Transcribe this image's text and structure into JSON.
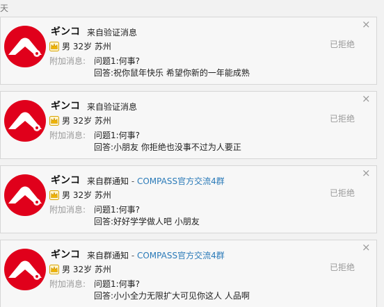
{
  "header": {
    "day_label": "天"
  },
  "requests": [
    {
      "name": "ギンコ",
      "source": "来自验证消息",
      "dash": "",
      "group": "",
      "profile": "男 32岁 苏州",
      "extra_label": "附加消息:",
      "question": "问题1:何事?",
      "answer": "回答:祝你鼠年快乐 希望你新的一年能成熟",
      "status": "已拒绝",
      "close": "×"
    },
    {
      "name": "ギンコ",
      "source": "来自验证消息",
      "dash": "",
      "group": "",
      "profile": "男 32岁 苏州",
      "extra_label": "附加消息:",
      "question": "问题1:何事?",
      "answer": "回答:小朋友 你拒绝也没事不过为人要正",
      "status": "已拒绝",
      "close": "×"
    },
    {
      "name": "ギンコ",
      "source": "来自群通知",
      "dash": " - ",
      "group": "COMPASS官方交流4群",
      "profile": "男 32岁 苏州",
      "extra_label": "附加消息:",
      "question": "问题1:何事?",
      "answer": "回答:好好学学做人吧 小朋友",
      "status": "已拒绝",
      "close": "×"
    },
    {
      "name": "ギンコ",
      "source": "来自群通知",
      "dash": " - ",
      "group": "COMPASS官方交流4群",
      "profile": "男 32岁 苏州",
      "extra_label": "附加消息:",
      "question": "问题1:何事?",
      "answer": "回答:小小全力无限扩大可见你这人 人品啊",
      "status": "已拒绝",
      "close": "×"
    }
  ],
  "icons": {
    "avatar": "mount-fuji-avatar",
    "vip": "vip-crown-icon",
    "close": "close-icon"
  },
  "colors": {
    "avatar_red": "#e0001b",
    "group_link": "#2a7ab8",
    "muted": "#999999"
  }
}
